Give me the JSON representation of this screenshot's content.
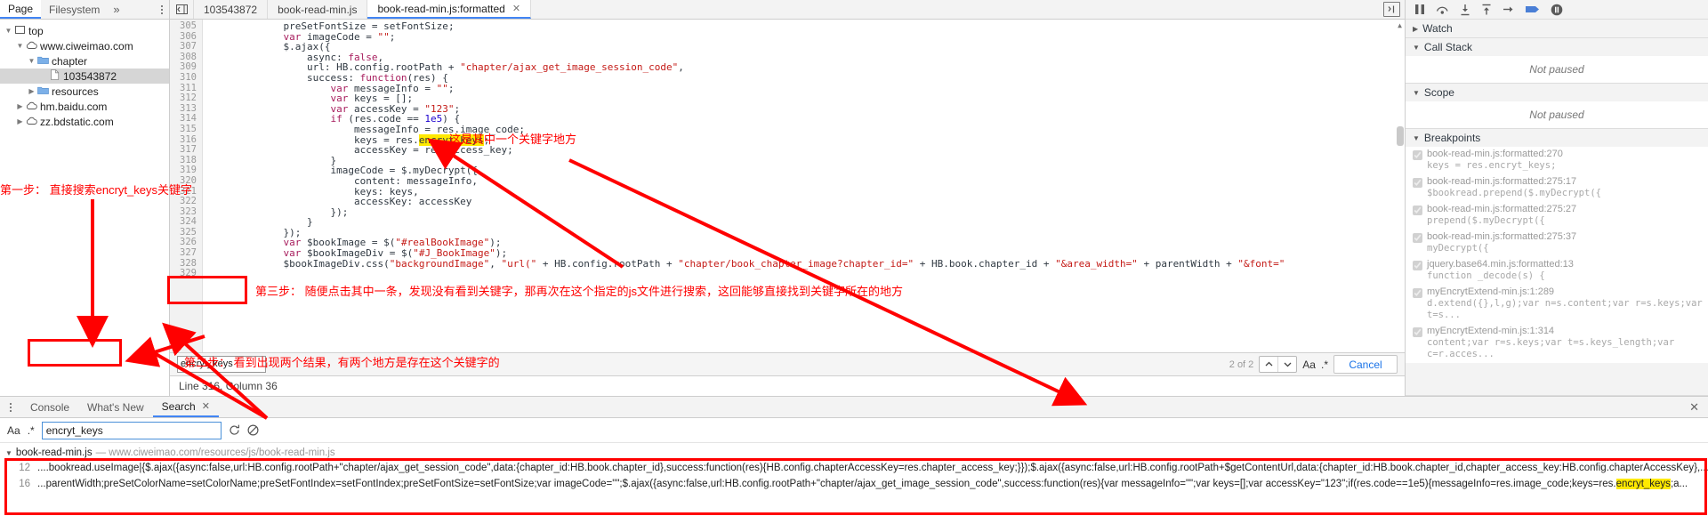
{
  "navigator": {
    "tabs": [
      {
        "label": "Page",
        "active": true
      },
      {
        "label": "Filesystem",
        "active": false
      }
    ],
    "more_label": "»",
    "tree": [
      {
        "indent": 0,
        "twist": "▼",
        "icon": "frame-icon",
        "label": "top"
      },
      {
        "indent": 1,
        "twist": "▼",
        "icon": "cloud-icon",
        "label": "www.ciweimao.com"
      },
      {
        "indent": 2,
        "twist": "▼",
        "icon": "folder-icon",
        "label": "chapter"
      },
      {
        "indent": 3,
        "twist": "",
        "icon": "file-icon",
        "label": "103543872",
        "selected": true
      },
      {
        "indent": 2,
        "twist": "▶",
        "icon": "folder-icon",
        "label": "resources"
      },
      {
        "indent": 1,
        "twist": "▶",
        "icon": "cloud-icon",
        "label": "hm.baidu.com"
      },
      {
        "indent": 1,
        "twist": "▶",
        "icon": "cloud-icon",
        "label": "zz.bdstatic.com"
      }
    ]
  },
  "editor": {
    "tabs": [
      {
        "label": "103543872",
        "active": false,
        "closable": false
      },
      {
        "label": "book-read-min.js",
        "active": false,
        "closable": false
      },
      {
        "label": "book-read-min.js:formatted",
        "active": true,
        "closable": true
      }
    ],
    "close_glyph": "✕",
    "lines": [
      {
        "no": "305",
        "tokens": [
          {
            "t": "            ",
            "c": "p"
          },
          {
            "t": "preSetFontSize",
            "c": "v"
          },
          {
            "t": " = ",
            "c": "p"
          },
          {
            "t": "setFontSize",
            "c": "v"
          },
          {
            "t": ";",
            "c": "p"
          }
        ]
      },
      {
        "no": "306",
        "tokens": [
          {
            "t": "            ",
            "c": "p"
          },
          {
            "t": "var",
            "c": "k"
          },
          {
            "t": " imageCode = ",
            "c": "p"
          },
          {
            "t": "\"\"",
            "c": "s"
          },
          {
            "t": ";",
            "c": "p"
          }
        ]
      },
      {
        "no": "307",
        "tokens": [
          {
            "t": "            ",
            "c": "p"
          },
          {
            "t": "$.ajax({",
            "c": "p"
          }
        ]
      },
      {
        "no": "308",
        "tokens": [
          {
            "t": "                ",
            "c": "p"
          },
          {
            "t": "async: ",
            "c": "p"
          },
          {
            "t": "false",
            "c": "k"
          },
          {
            "t": ",",
            "c": "p"
          }
        ]
      },
      {
        "no": "309",
        "tokens": [
          {
            "t": "                ",
            "c": "p"
          },
          {
            "t": "url: HB.config.rootPath + ",
            "c": "p"
          },
          {
            "t": "\"chapter/ajax_get_image_session_code\"",
            "c": "s"
          },
          {
            "t": ",",
            "c": "p"
          }
        ]
      },
      {
        "no": "310",
        "tokens": [
          {
            "t": "                ",
            "c": "p"
          },
          {
            "t": "success: ",
            "c": "p"
          },
          {
            "t": "function",
            "c": "k"
          },
          {
            "t": "(res) {",
            "c": "p"
          }
        ]
      },
      {
        "no": "311",
        "tokens": [
          {
            "t": "                    ",
            "c": "p"
          },
          {
            "t": "var",
            "c": "k"
          },
          {
            "t": " messageInfo = ",
            "c": "p"
          },
          {
            "t": "\"\"",
            "c": "s"
          },
          {
            "t": ";",
            "c": "p"
          }
        ]
      },
      {
        "no": "312",
        "tokens": [
          {
            "t": "                    ",
            "c": "p"
          },
          {
            "t": "var",
            "c": "k"
          },
          {
            "t": " keys = [];",
            "c": "p"
          }
        ]
      },
      {
        "no": "313",
        "tokens": [
          {
            "t": "                    ",
            "c": "p"
          },
          {
            "t": "var",
            "c": "k"
          },
          {
            "t": " accessKey = ",
            "c": "p"
          },
          {
            "t": "\"123\"",
            "c": "s"
          },
          {
            "t": ";",
            "c": "p"
          }
        ]
      },
      {
        "no": "314",
        "tokens": [
          {
            "t": "                    ",
            "c": "p"
          },
          {
            "t": "if",
            "c": "k"
          },
          {
            "t": " (res.code == ",
            "c": "p"
          },
          {
            "t": "1e5",
            "c": "n"
          },
          {
            "t": ") {",
            "c": "p"
          }
        ]
      },
      {
        "no": "315",
        "tokens": [
          {
            "t": "                        ",
            "c": "p"
          },
          {
            "t": "messageInfo = res.image_code;",
            "c": "p"
          }
        ]
      },
      {
        "no": "316",
        "tokens": [
          {
            "t": "                        ",
            "c": "p"
          },
          {
            "t": "keys = res.",
            "c": "p"
          },
          {
            "t": "encryt_keys",
            "c": "hl"
          },
          {
            "t": ";",
            "c": "p"
          }
        ]
      },
      {
        "no": "317",
        "tokens": [
          {
            "t": "                        ",
            "c": "p"
          },
          {
            "t": "accessKey = res.access_key;",
            "c": "p"
          }
        ]
      },
      {
        "no": "318",
        "tokens": [
          {
            "t": "                    ",
            "c": "p"
          },
          {
            "t": "}",
            "c": "p"
          }
        ]
      },
      {
        "no": "319",
        "tokens": [
          {
            "t": "                    ",
            "c": "p"
          },
          {
            "t": "imageCode = $.myDecrypt({",
            "c": "p"
          }
        ]
      },
      {
        "no": "320",
        "tokens": [
          {
            "t": "                        ",
            "c": "p"
          },
          {
            "t": "content: messageInfo,",
            "c": "p"
          }
        ]
      },
      {
        "no": "321",
        "tokens": [
          {
            "t": "                        ",
            "c": "p"
          },
          {
            "t": "keys: keys,",
            "c": "p"
          }
        ]
      },
      {
        "no": "322",
        "tokens": [
          {
            "t": "                        ",
            "c": "p"
          },
          {
            "t": "accessKey: accessKey",
            "c": "p"
          }
        ]
      },
      {
        "no": "323",
        "tokens": [
          {
            "t": "                    ",
            "c": "p"
          },
          {
            "t": "});",
            "c": "p"
          }
        ]
      },
      {
        "no": "324",
        "tokens": [
          {
            "t": "                ",
            "c": "p"
          },
          {
            "t": "}",
            "c": "p"
          }
        ]
      },
      {
        "no": "325",
        "tokens": [
          {
            "t": "            ",
            "c": "p"
          },
          {
            "t": "});",
            "c": "p"
          }
        ]
      },
      {
        "no": "326",
        "tokens": [
          {
            "t": "            ",
            "c": "p"
          },
          {
            "t": "var",
            "c": "k"
          },
          {
            "t": " $bookImage = $(",
            "c": "p"
          },
          {
            "t": "\"#realBookImage\"",
            "c": "s"
          },
          {
            "t": ");",
            "c": "p"
          }
        ]
      },
      {
        "no": "327",
        "tokens": [
          {
            "t": "            ",
            "c": "p"
          },
          {
            "t": "var",
            "c": "k"
          },
          {
            "t": " $bookImageDiv = $(",
            "c": "p"
          },
          {
            "t": "\"#J_BookImage\"",
            "c": "s"
          },
          {
            "t": ");",
            "c": "p"
          }
        ]
      },
      {
        "no": "328",
        "tokens": [
          {
            "t": "            ",
            "c": "p"
          },
          {
            "t": "$bookImageDiv.css(",
            "c": "p"
          },
          {
            "t": "\"backgroundImage\"",
            "c": "s"
          },
          {
            "t": ", ",
            "c": "p"
          },
          {
            "t": "\"url(\"",
            "c": "s"
          },
          {
            "t": " + HB.config.rootPath + ",
            "c": "p"
          },
          {
            "t": "\"chapter/book_chapter_image?chapter_id=\"",
            "c": "s"
          },
          {
            "t": " + HB.book.chapter_id + ",
            "c": "p"
          },
          {
            "t": "\"&area_width=\"",
            "c": "s"
          },
          {
            "t": " + parentWidth + ",
            "c": "p"
          },
          {
            "t": "\"&font=\"",
            "c": "s"
          }
        ]
      },
      {
        "no": "329",
        "tokens": [
          {
            "t": "",
            "c": "p"
          }
        ]
      }
    ],
    "find": {
      "value": "encryt_keys",
      "match_count": "2 of 2",
      "prev_glyph": "⌃",
      "next_glyph": "⌄",
      "match_case_label": "Aa",
      "regex_label": ".*",
      "cancel_label": "Cancel"
    },
    "status": "Line 316, Column 36"
  },
  "debugger": {
    "toolbar_icons": [
      "pause-icon",
      "step-over-icon",
      "step-into-icon",
      "step-out-icon",
      "step-icon",
      "deactivate-breakpoints-icon",
      "pause-on-exceptions-icon"
    ],
    "sections": [
      {
        "name": "Watch",
        "expanded": false,
        "body": null
      },
      {
        "name": "Call Stack",
        "expanded": true,
        "body": "Not paused"
      },
      {
        "name": "Scope",
        "expanded": true,
        "body": "Not paused"
      },
      {
        "name": "Breakpoints",
        "expanded": true,
        "body": null
      }
    ],
    "breakpoints": [
      {
        "location": "book-read-min.js:formatted:270",
        "snippet": "keys = res.encryt_keys;",
        "checked": true
      },
      {
        "location": "book-read-min.js:formatted:275:17",
        "snippet": "$bookread.prepend($.myDecrypt({",
        "checked": true
      },
      {
        "location": "book-read-min.js:formatted:275:27",
        "snippet": "prepend($.myDecrypt({",
        "checked": true
      },
      {
        "location": "book-read-min.js:formatted:275:37",
        "snippet": "myDecrypt({",
        "checked": true
      },
      {
        "location": "jquery.base64.min.js:formatted:13",
        "snippet": "function _decode(s) {",
        "checked": true
      },
      {
        "location": "myEncrytExtend-min.js:1:289",
        "snippet": "d.extend({},l,g);var n=s.content;var r=s.keys;var t=s...",
        "checked": true
      },
      {
        "location": "myEncrytExtend-min.js:1:314",
        "snippet": "content;var r=s.keys;var t=s.keys_length;var c=r.acces...",
        "checked": true
      }
    ]
  },
  "drawer": {
    "tabs": [
      {
        "label": "Console",
        "active": false,
        "closable": false
      },
      {
        "label": "What's New",
        "active": false,
        "closable": false
      },
      {
        "label": "Search",
        "active": true,
        "closable": true
      }
    ],
    "close_glyph": "✕",
    "panel_close_glyph": "✕",
    "search": {
      "match_case_label": "Aa",
      "regex_label": ".*",
      "value": "encryt_keys",
      "refresh_icon": "refresh-icon",
      "clear_icon": "clear-icon"
    },
    "results": {
      "file_name": "book-read-min.js",
      "file_url": "— www.ciweimao.com/resources/js/book-read-min.js",
      "twist": "▼",
      "rows": [
        {
          "line": "12",
          "pre": "....bookread.useImage|{$.ajax({async:false,url:HB.config.rootPath+\"chapter/ajax_get_session_code\",data:{chapter_id:HB.book.chapter_id},success:function(res){HB.config.chapterAccessKey=res.chapter_access_key;}});$.ajax({async:false,url:HB.config.rootPath+$getContentUrl,data:{chapter_id:HB.book.chapter_id,chapter_access_key:HB.config.chapterAccessKey},...",
          "match": "",
          "post": ""
        },
        {
          "line": "16",
          "pre": "...parentWidth;preSetColorName=setColorName;preSetFontIndex=setFontIndex;preSetFontSize=setFontSize;var imageCode=\"\";$.ajax({async:false,url:HB.config.rootPath+\"chapter/ajax_get_image_session_code\",success:function(res){var messageInfo=\"\";var keys=[];var accessKey=\"123\";if(res.code==1e5){messageInfo=res.image_code;keys=res.",
          "match": "encryt_keys",
          "post": ";a..."
        }
      ]
    }
  },
  "annotations": [
    {
      "id": "step1",
      "text": "第一步： 直接搜索encryt_keys关键字"
    },
    {
      "id": "step2",
      "text": "第二步： 看到出现两个结果，有两个地方是存在这个关键字的"
    },
    {
      "id": "step3",
      "text": "第三步： 随便点击其中一条，发现没有看到关键字，那再次在这个指定的js文件进行搜索，这回能够直接找到关键字所在的地方"
    },
    {
      "id": "keyword-note",
      "text": "这是其中一个关键字地方"
    }
  ],
  "colors": {
    "accent": "#4285f4",
    "annotation": "#ff0000",
    "highlight": "#ffe900",
    "link": "#1a73e8"
  }
}
